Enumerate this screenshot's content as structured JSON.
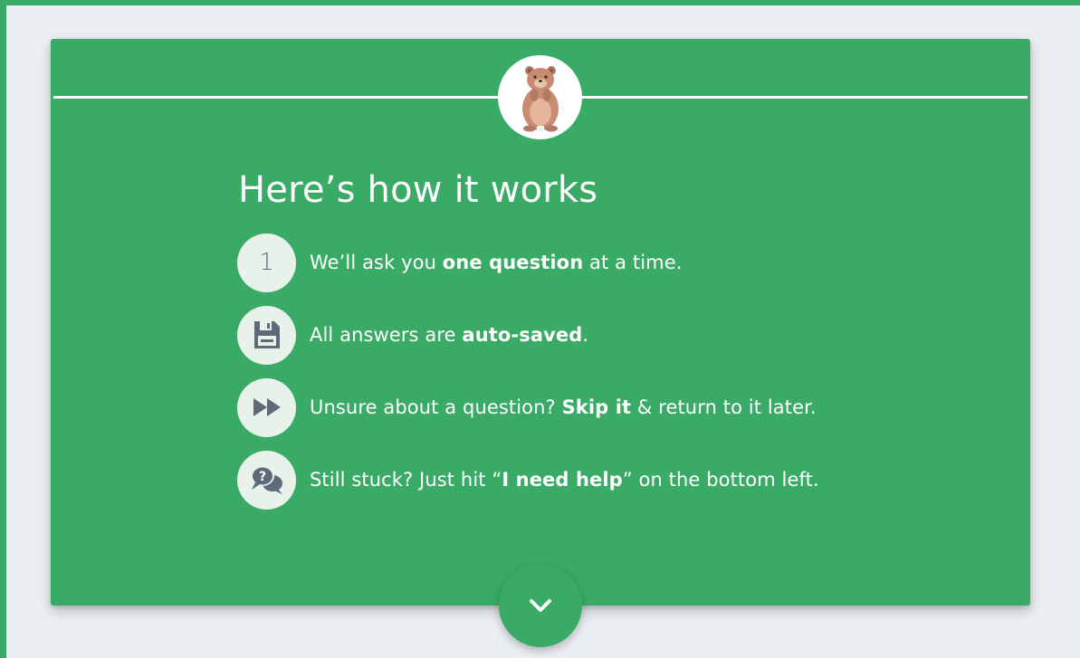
{
  "intro": {
    "title": "Here’s how it works",
    "mascot_icon": "groundhog-icon",
    "steps": [
      {
        "icon": "number-one-icon",
        "number": "1",
        "text_before": "We’ll ask you ",
        "text_bold": "one question",
        "text_after": " at a time."
      },
      {
        "icon": "save-disk-icon",
        "text_before": "All answers are ",
        "text_bold": "auto-saved",
        "text_after": "."
      },
      {
        "icon": "fast-forward-icon",
        "text_before": "Unsure about a question? ",
        "text_bold": "Skip it",
        "text_after": " & return to it later."
      },
      {
        "icon": "help-chat-icon",
        "text_before": "Still stuck? Just hit “",
        "text_bold": "I need help",
        "text_after": "” on the bottom left."
      }
    ],
    "next_icon": "chevron-down-icon"
  },
  "colors": {
    "brand_green": "#3aab66",
    "background": "#ebeef2",
    "icon_circle": "#e8f2ea",
    "icon_gray": "#5d6b78",
    "text": "#ffffff"
  }
}
